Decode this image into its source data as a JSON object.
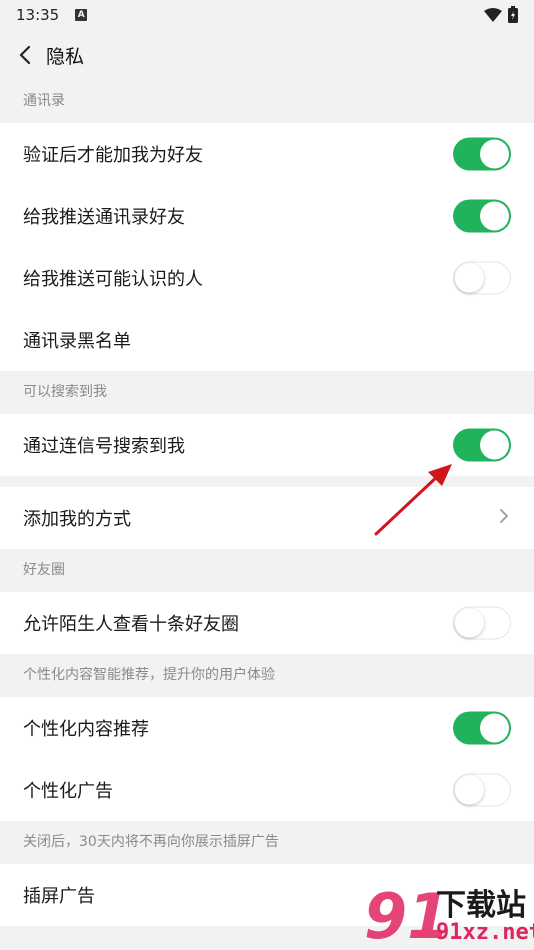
{
  "status_bar": {
    "time": "13:35",
    "a_icon": "A"
  },
  "header": {
    "title": "隐私",
    "back_icon": "chevron-left-icon"
  },
  "sections": {
    "contacts": {
      "label": "通讯录",
      "rows": [
        {
          "label": "验证后才能加我为好友",
          "toggle": "on"
        },
        {
          "label": "给我推送通讯录好友",
          "toggle": "on"
        },
        {
          "label": "给我推送可能认识的人",
          "toggle": "off"
        },
        {
          "label": "通讯录黑名单"
        }
      ]
    },
    "search": {
      "label": "可以搜索到我",
      "rows": [
        {
          "label": "通过连信号搜索到我",
          "toggle": "on"
        }
      ]
    },
    "add_method": {
      "label": "添加我的方式"
    },
    "moments": {
      "label": "好友圈",
      "rows": [
        {
          "label": "允许陌生人查看十条好友圈",
          "toggle": "off"
        }
      ]
    },
    "personalized": {
      "label": "个性化内容智能推荐，提升你的用户体验",
      "rows": [
        {
          "label": "个性化内容推荐",
          "toggle": "on"
        },
        {
          "label": "个性化广告",
          "toggle": "off"
        }
      ]
    },
    "interstitial": {
      "label": "关闭后，30天内将不再向你展示插屏广告",
      "rows": [
        {
          "label": "插屏广告"
        }
      ]
    }
  },
  "watermark": {
    "brand": "下载站",
    "url": "91xz.net"
  },
  "colors": {
    "toggle_on": "#21b25c",
    "background": "#f2f2f2",
    "arrow": "#d0151b"
  }
}
